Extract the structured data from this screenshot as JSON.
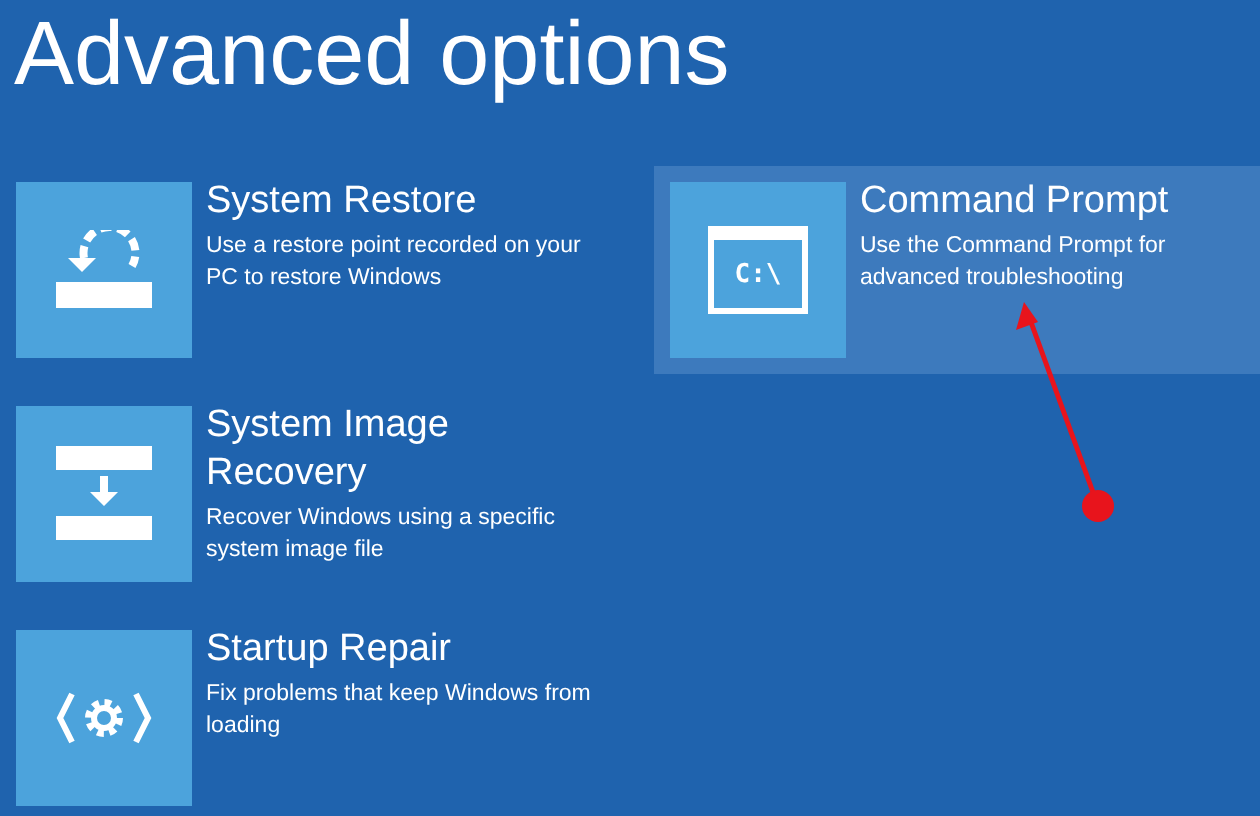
{
  "title": "Advanced options",
  "left_options": [
    {
      "kind": "restore",
      "title": "System Restore",
      "description": "Use a restore point recorded on your PC to restore Windows",
      "selected": false
    },
    {
      "kind": "image",
      "title": "System Image Recovery",
      "description": "Recover Windows using a specific system image file",
      "selected": false
    },
    {
      "kind": "repair",
      "title": "Startup Repair",
      "description": "Fix problems that keep Windows from loading",
      "selected": false
    }
  ],
  "right_options": [
    {
      "kind": "prompt",
      "title": "Command Prompt",
      "description": "Use the Command Prompt for advanced troubleshooting",
      "selected": true,
      "icon_text": "C:\\"
    }
  ]
}
